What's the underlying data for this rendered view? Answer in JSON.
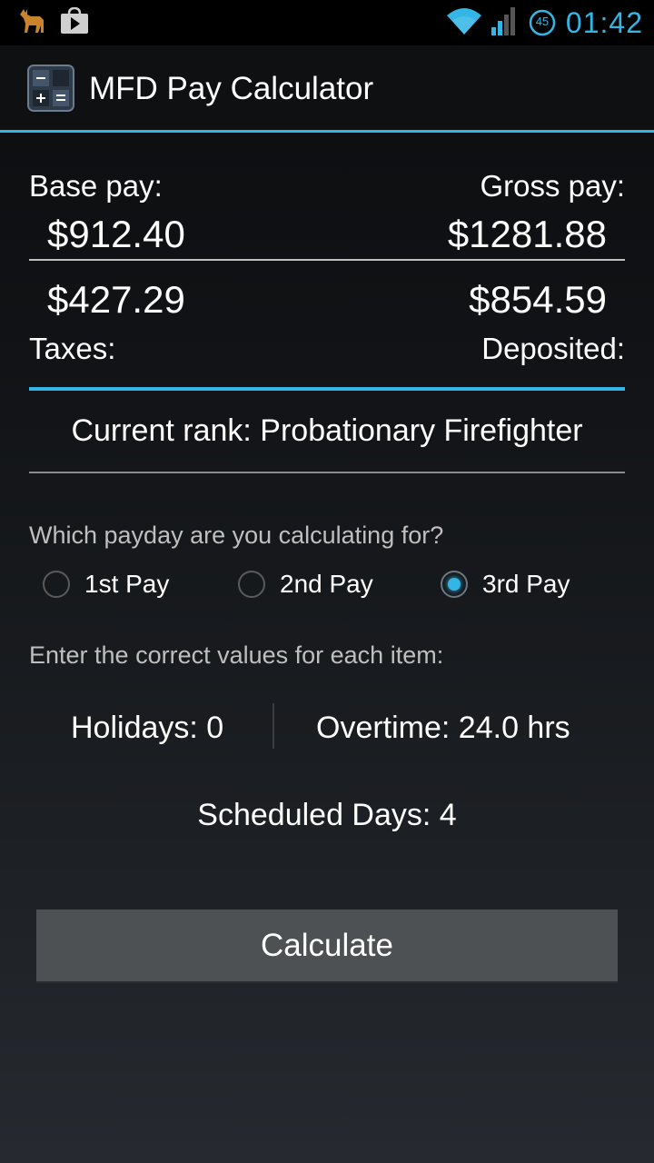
{
  "status_bar": {
    "time": "01:42",
    "battery_level": "45",
    "icons": [
      "deer-notification-icon",
      "play-store-icon",
      "wifi-icon",
      "cell-signal-icon",
      "battery-icon"
    ]
  },
  "app": {
    "title": "MFD Pay Calculator",
    "accent_color": "#33b5e5"
  },
  "summary": {
    "base_pay_label": "Base pay:",
    "base_pay_value": "$912.40",
    "gross_pay_label": "Gross pay:",
    "gross_pay_value": "$1281.88",
    "taxes_value": "$427.29",
    "taxes_label": "Taxes:",
    "deposited_value": "$854.59",
    "deposited_label": "Deposited:"
  },
  "rank": {
    "text": "Current rank: Probationary Firefighter"
  },
  "payday": {
    "question": "Which payday are you calculating for?",
    "options": [
      "1st Pay",
      "2nd Pay",
      "3rd Pay"
    ],
    "selected": "3rd Pay"
  },
  "items": {
    "instructions": "Enter the correct values for each item:",
    "holidays": "Holidays: 0",
    "overtime": "Overtime: 24.0 hrs",
    "scheduled_days": "Scheduled Days: 4"
  },
  "actions": {
    "calculate_label": "Calculate"
  }
}
